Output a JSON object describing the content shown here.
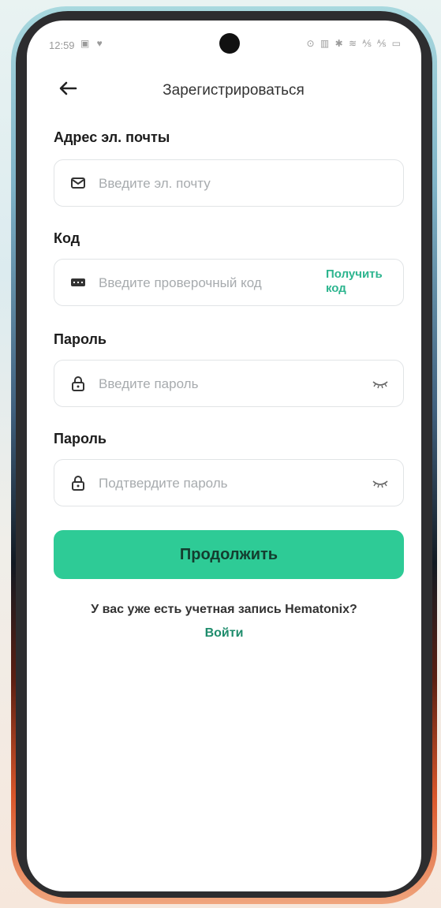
{
  "status_bar": {
    "time": "12:59",
    "left_icons": "▣ ♥",
    "right_icons": "⊙ ▥ ✱ ≋ ⅍ ⅍ ▭"
  },
  "header": {
    "title": "Зарегистрироваться"
  },
  "email": {
    "label": "Адрес эл. почты",
    "placeholder": "Введите эл. почту"
  },
  "code": {
    "label": "Код",
    "placeholder": "Введите проверочный код",
    "get_code": "Получить код"
  },
  "password": {
    "label": "Пароль",
    "placeholder": "Введите пароль"
  },
  "confirm_password": {
    "label": "Пароль",
    "placeholder": "Подтвердите пароль"
  },
  "continue_label": "Продолжить",
  "footer": {
    "prompt": "У вас уже есть учетная запись Hematonix?",
    "login": "Войти"
  },
  "colors": {
    "accent": "#2ecb96",
    "link": "#2db58f"
  }
}
